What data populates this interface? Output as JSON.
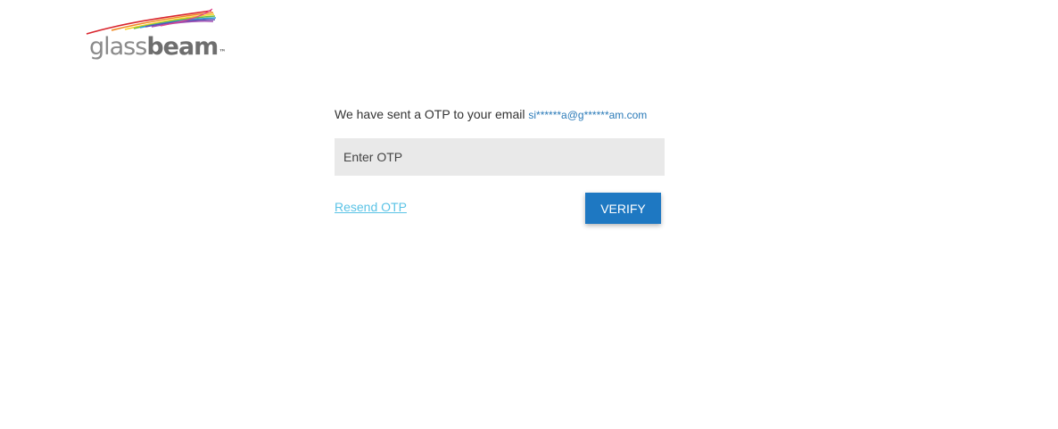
{
  "logo": {
    "text_light": "glass",
    "text_bold": "beam",
    "trademark": "™"
  },
  "otp": {
    "message": "We have sent a OTP to your email",
    "email": "si******a@g******am.com",
    "input_placeholder": "Enter OTP",
    "input_value": "",
    "resend_label": "Resend OTP",
    "verify_label": "VERIFY"
  },
  "colors": {
    "button_bg": "#1e78c2",
    "link": "#5bc3e6",
    "email_text": "#2a7ab8",
    "input_bg": "#e9e9e9"
  }
}
